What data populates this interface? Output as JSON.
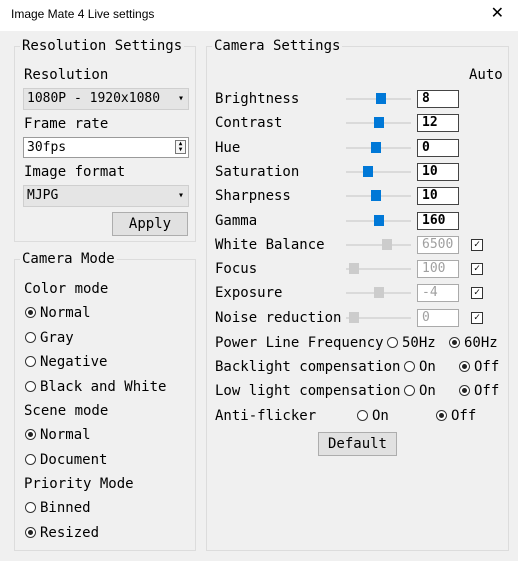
{
  "window": {
    "title": "Image Mate 4 Live settings",
    "close_glyph": "✕"
  },
  "resolution": {
    "legend": "Resolution Settings",
    "resolution_label": "Resolution",
    "resolution_value": "1080P - 1920x1080",
    "frame_rate_label": "Frame rate",
    "frame_rate_value": "30fps",
    "image_format_label": "Image format",
    "image_format_value": "MJPG",
    "apply_label": "Apply"
  },
  "camera_mode": {
    "legend": "Camera Mode",
    "color_mode_label": "Color mode",
    "color_options": [
      {
        "label": "Normal",
        "checked": true
      },
      {
        "label": "Gray",
        "checked": false
      },
      {
        "label": "Negative",
        "checked": false
      },
      {
        "label": "Black and White",
        "checked": false
      }
    ],
    "scene_mode_label": "Scene mode",
    "scene_options": [
      {
        "label": "Normal",
        "checked": true
      },
      {
        "label": "Document",
        "checked": false
      }
    ],
    "priority_mode_label": "Priority Mode",
    "priority_options": [
      {
        "label": "Binned",
        "checked": false
      },
      {
        "label": "Resized",
        "checked": true
      }
    ]
  },
  "camera_settings": {
    "legend": "Camera Settings",
    "auto_label": "Auto",
    "sliders": [
      {
        "label": "Brightness",
        "value": "8",
        "pos": 0.55,
        "enabled": true,
        "auto": null
      },
      {
        "label": "Contrast",
        "value": "12",
        "pos": 0.5,
        "enabled": true,
        "auto": null
      },
      {
        "label": "Hue",
        "value": "0",
        "pos": 0.45,
        "enabled": true,
        "auto": null
      },
      {
        "label": "Saturation",
        "value": "10",
        "pos": 0.3,
        "enabled": true,
        "auto": null
      },
      {
        "label": "Sharpness",
        "value": "10",
        "pos": 0.45,
        "enabled": true,
        "auto": null
      },
      {
        "label": "Gamma",
        "value": "160",
        "pos": 0.5,
        "enabled": true,
        "auto": null
      },
      {
        "label": "White Balance",
        "value": "6500",
        "pos": 0.65,
        "enabled": false,
        "auto": true
      },
      {
        "label": "Focus",
        "value": "100",
        "pos": 0.05,
        "enabled": false,
        "auto": true
      },
      {
        "label": "Exposure",
        "value": "-4",
        "pos": 0.5,
        "enabled": false,
        "auto": true
      },
      {
        "label": "Noise reduction",
        "value": "0",
        "pos": 0.05,
        "enabled": false,
        "auto": true
      }
    ],
    "power_line": {
      "label": "Power Line Frequency",
      "opt1": "50Hz",
      "opt2": "60Hz",
      "selected": 2
    },
    "backlight": {
      "label": "Backlight compensation",
      "opt1": "On",
      "opt2": "Off",
      "selected": 2
    },
    "low_light": {
      "label": "Low light compensation",
      "opt1": "On",
      "opt2": "Off",
      "selected": 2
    },
    "anti_flicker": {
      "label": "Anti-flicker",
      "opt1": "On",
      "opt2": "Off",
      "selected": 2
    },
    "default_label": "Default"
  },
  "colors": {
    "accent": "#0078d7",
    "disabled_thumb": "#cccccc"
  }
}
